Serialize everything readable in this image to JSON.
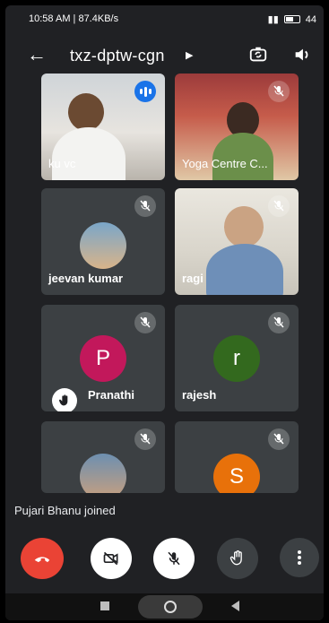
{
  "status_bar": {
    "time_speed": "10:58 AM | 87.4KB/s",
    "right": "44"
  },
  "header": {
    "back_icon": "arrow-left-icon",
    "meeting_code": "txz-dptw-cgn",
    "caret_icon": "caret-right-icon",
    "switch_camera_icon": "switch-camera-icon",
    "audio_output_icon": "speaker-icon"
  },
  "participants": [
    {
      "name": "ku vc",
      "state": "speaking",
      "video": true
    },
    {
      "name": "Yoga Centre C...",
      "state": "muted",
      "video": true
    },
    {
      "name": "jeevan kumar",
      "state": "muted",
      "video": false
    },
    {
      "name": "ragi",
      "state": "muted",
      "video": true
    },
    {
      "name": "Pranathi",
      "state": "muted",
      "avatar_letter": "P",
      "avatar_color": "#c2185b",
      "hand_raised": true
    },
    {
      "name": "rajesh",
      "state": "muted",
      "avatar_letter": "r",
      "avatar_color": "#33691e"
    },
    {
      "name": "",
      "state": "muted",
      "video": false
    },
    {
      "name": "",
      "state": "muted",
      "avatar_letter": "S",
      "avatar_color": "#e8710a"
    }
  ],
  "toast": "Pujari Bhanu joined",
  "controls": {
    "end_call_icon": "end-call-icon",
    "camera_icon": "camera-off-icon",
    "mic_icon": "mic-off-icon",
    "raise_hand_icon": "raise-hand-icon",
    "more_icon": "more-vertical-icon"
  },
  "colors": {
    "background": "#202124",
    "tile": "#3c4043",
    "end_call": "#ea4335",
    "speaking": "#1a73e8"
  }
}
